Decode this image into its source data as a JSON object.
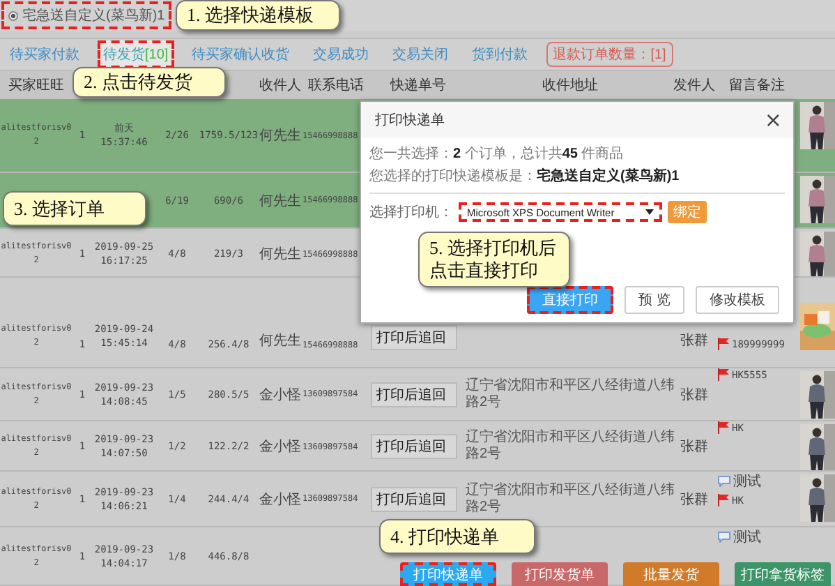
{
  "template_option": {
    "label": "宅急送自定义(菜鸟新)1",
    "checked": true,
    "highlighted": true
  },
  "tabs": [
    {
      "label": "待买家付款",
      "kind": "tab",
      "selected": false,
      "highlighted": false
    },
    {
      "label": "待发货",
      "count": "[10]",
      "kind": "tab",
      "selected": true,
      "highlighted": true
    },
    {
      "label": "待买家确认收货",
      "kind": "tab",
      "selected": false,
      "highlighted": false
    },
    {
      "label": "交易成功",
      "kind": "tab",
      "selected": false,
      "highlighted": false
    },
    {
      "label": "交易关闭",
      "kind": "tab",
      "selected": false,
      "highlighted": false
    },
    {
      "label": "货到付款",
      "kind": "tab",
      "selected": false,
      "highlighted": false
    },
    {
      "label": "退款订单数量：[1]",
      "kind": "alert",
      "selected": false,
      "highlighted": false
    }
  ],
  "columns": [
    "买家旺旺",
    "收件人",
    "联系电话",
    "快递单号",
    "收件地址",
    "发件人",
    "留言备注"
  ],
  "rows": [
    {
      "selected": true,
      "buyer": "alitestforisv02",
      "qty": "1",
      "time": [
        "前天",
        "15:37:46"
      ],
      "count": "2/26",
      "price": "1759.5/123",
      "name": "何先生",
      "phone": "15466998888",
      "thumb": {
        "kind": "picture"
      }
    },
    {
      "selected": true,
      "count": "6/19",
      "price": "690/6",
      "name": "何先生",
      "phone": "15466998888",
      "thumb": {
        "kind": "picture"
      }
    },
    {
      "selected": false,
      "buyer": "alitestforisv02",
      "qty": "1",
      "time": [
        "2019-09-25",
        "16:17:25"
      ],
      "count": "4/8",
      "price": "219/3",
      "name": "何先生",
      "phone": "15466998888",
      "thumb": {
        "kind": "picture"
      }
    },
    {
      "selected": false,
      "buyer": "alitestforisv02",
      "qty": "1",
      "time": [
        "2019-09-24",
        "15:45:14"
      ],
      "count": "4/8",
      "price": "256.4/8",
      "name": "何先生",
      "phone": "15466998888",
      "tracking": "打印后追回",
      "sender": "张群",
      "memo": [
        {
          "kind": "flag",
          "text": "189999999"
        }
      ],
      "thumb": {
        "kind": "picture"
      }
    },
    {
      "selected": false,
      "buyer": "alitestforisv02",
      "qty": "1",
      "time": [
        "2019-09-23",
        "14:08:45"
      ],
      "count": "1/5",
      "price": "280.5/5",
      "name": "金小怪",
      "phone": "13609897584",
      "tracking": "打印后追回",
      "address": "辽宁省沈阳市和平区八经街道八纬路2号",
      "sender": "张群",
      "memo": [
        {
          "kind": "flag",
          "text": "HK5555"
        }
      ],
      "thumb": {
        "kind": "picture"
      }
    },
    {
      "selected": false,
      "buyer": "alitestforisv02",
      "qty": "1",
      "time": [
        "2019-09-23",
        "14:07:50"
      ],
      "count": "1/2",
      "price": "122.2/2",
      "name": "金小怪",
      "phone": "13609897584",
      "tracking": "打印后追回",
      "address": "辽宁省沈阳市和平区八经街道八纬路2号",
      "sender": "张群",
      "memo": [
        {
          "kind": "flag",
          "text": "HK"
        }
      ],
      "thumb": {
        "kind": "picture"
      }
    },
    {
      "selected": false,
      "buyer": "alitestforisv02",
      "qty": "1",
      "time": [
        "2019-09-23",
        "14:06:21"
      ],
      "count": "1/4",
      "price": "244.4/4",
      "name": "金小怪",
      "phone": "13609897584",
      "tracking": "打印后追回",
      "address": "辽宁省沈阳市和平区八经街道八纬路2号",
      "sender": "张群",
      "memo": [
        {
          "kind": "comment",
          "text": "测试"
        },
        {
          "kind": "flag",
          "text": "HK"
        }
      ],
      "thumb": {
        "kind": "picture"
      }
    },
    {
      "selected": false,
      "buyer": "alitestforisv02",
      "qty": "1",
      "time": [
        "2019-09-23",
        "14:04:17"
      ],
      "count": "1/8",
      "price": "446.8/8",
      "memo": [
        {
          "kind": "comment",
          "text": "测试"
        }
      ]
    }
  ],
  "dialog": {
    "title": "打印快递单",
    "close": "×",
    "summary": "您一共选择：**2** 个订单，总计共**45** 件商品",
    "template_line": "您选择的打印快递模板是：**宅急送自定义(菜鸟新)1**",
    "printer_label": "选择打印机：",
    "printer": {
      "value": "Microsoft XPS Document Writer",
      "highlighted": true
    },
    "bind_button": "绑定",
    "buttons": [
      {
        "label": "直接打印",
        "kind": "primary",
        "highlighted": true
      },
      {
        "label": "预 览",
        "kind": "default",
        "highlighted": false
      },
      {
        "label": "修改模板",
        "kind": "default",
        "highlighted": false
      }
    ]
  },
  "footer_buttons": [
    {
      "label": "打印快递单",
      "color": "#2aa8f0",
      "highlighted": true
    },
    {
      "label": "打印发货单",
      "color": "#c96868",
      "highlighted": false
    },
    {
      "label": "批量发货",
      "color": "#d07a2a",
      "highlighted": false
    },
    {
      "label": "打印拿货标签",
      "color": "#3c9468",
      "highlighted": false
    }
  ],
  "callouts": [
    {
      "text": "1. 选择快递模板"
    },
    {
      "text": "2. 点击待发货"
    },
    {
      "text": "3. 选择订单"
    },
    {
      "text": "5. 选择打印机后点击直接打印"
    },
    {
      "text": "4. 打印快递单"
    }
  ]
}
